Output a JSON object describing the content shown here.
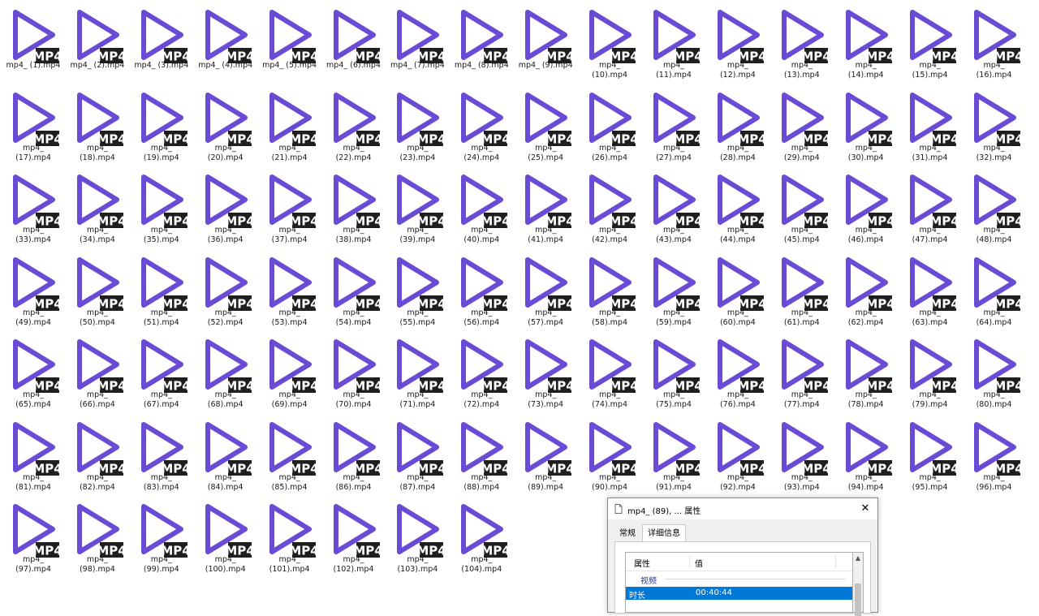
{
  "files": [
    "mp4_ (1).mp4",
    "mp4_ (2).mp4",
    "mp4_ (3).mp4",
    "mp4_ (4).mp4",
    "mp4_ (5).mp4",
    "mp4_ (6).mp4",
    "mp4_ (7).mp4",
    "mp4_ (8).mp4",
    "mp4_ (9).mp4",
    "mp4_\n(10).mp4",
    "mp4_\n(11).mp4",
    "mp4_\n(12).mp4",
    "mp4_\n(13).mp4",
    "mp4_\n(14).mp4",
    "mp4_\n(15).mp4",
    "mp4_\n(16).mp4",
    "mp4_\n(17).mp4",
    "mp4_\n(18).mp4",
    "mp4_\n(19).mp4",
    "mp4_\n(20).mp4",
    "mp4_\n(21).mp4",
    "mp4_\n(22).mp4",
    "mp4_\n(23).mp4",
    "mp4_\n(24).mp4",
    "mp4_\n(25).mp4",
    "mp4_\n(26).mp4",
    "mp4_\n(27).mp4",
    "mp4_\n(28).mp4",
    "mp4_\n(29).mp4",
    "mp4_\n(30).mp4",
    "mp4_\n(31).mp4",
    "mp4_\n(32).mp4",
    "mp4_\n(33).mp4",
    "mp4_\n(34).mp4",
    "mp4_\n(35).mp4",
    "mp4_\n(36).mp4",
    "mp4_\n(37).mp4",
    "mp4_\n(38).mp4",
    "mp4_\n(39).mp4",
    "mp4_\n(40).mp4",
    "mp4_\n(41).mp4",
    "mp4_\n(42).mp4",
    "mp4_\n(43).mp4",
    "mp4_\n(44).mp4",
    "mp4_\n(45).mp4",
    "mp4_\n(46).mp4",
    "mp4_\n(47).mp4",
    "mp4_\n(48).mp4",
    "mp4_\n(49).mp4",
    "mp4_\n(50).mp4",
    "mp4_\n(51).mp4",
    "mp4_\n(52).mp4",
    "mp4_\n(53).mp4",
    "mp4_\n(54).mp4",
    "mp4_\n(55).mp4",
    "mp4_\n(56).mp4",
    "mp4_\n(57).mp4",
    "mp4_\n(58).mp4",
    "mp4_\n(59).mp4",
    "mp4_\n(60).mp4",
    "mp4_\n(61).mp4",
    "mp4_\n(62).mp4",
    "mp4_\n(63).mp4",
    "mp4_\n(64).mp4",
    "mp4_\n(65).mp4",
    "mp4_\n(66).mp4",
    "mp4_\n(67).mp4",
    "mp4_\n(68).mp4",
    "mp4_\n(69).mp4",
    "mp4_\n(70).mp4",
    "mp4_\n(71).mp4",
    "mp4_\n(72).mp4",
    "mp4_\n(73).mp4",
    "mp4_\n(74).mp4",
    "mp4_\n(75).mp4",
    "mp4_\n(76).mp4",
    "mp4_\n(77).mp4",
    "mp4_\n(78).mp4",
    "mp4_\n(79).mp4",
    "mp4_\n(80).mp4",
    "mp4_\n(81).mp4",
    "mp4_\n(82).mp4",
    "mp4_\n(83).mp4",
    "mp4_\n(84).mp4",
    "mp4_\n(85).mp4",
    "mp4_\n(86).mp4",
    "mp4_\n(87).mp4",
    "mp4_\n(88).mp4",
    "mp4_\n(89).mp4",
    "mp4_\n(90).mp4",
    "mp4_\n(91).mp4",
    "mp4_\n(92).mp4",
    "mp4_\n(93).mp4",
    "mp4_\n(94).mp4",
    "mp4_\n(95).mp4",
    "mp4_\n(96).mp4",
    "mp4_\n(97).mp4",
    "mp4_\n(98).mp4",
    "mp4_\n(99).mp4",
    "mp4_\n(100).mp4",
    "mp4_\n(101).mp4",
    "mp4_\n(102).mp4",
    "mp4_\n(103).mp4",
    "mp4_\n(104).mp4"
  ],
  "icon": {
    "badge_text": "MP4",
    "play_color": "#6a4bd6",
    "badge_color": "#1f1f1f",
    "semantic": "mp4-file-icon"
  },
  "dialog": {
    "title": "mp4_ (89), ... 属性",
    "close_glyph": "✕",
    "tabs": [
      "常规",
      "详细信息"
    ],
    "active_tab": "详细信息",
    "columns": [
      "属性",
      "值"
    ],
    "group": "视频",
    "selected_row": {
      "key": "时长",
      "value": "00:40:44"
    },
    "scroll_up_glyph": "▲"
  }
}
